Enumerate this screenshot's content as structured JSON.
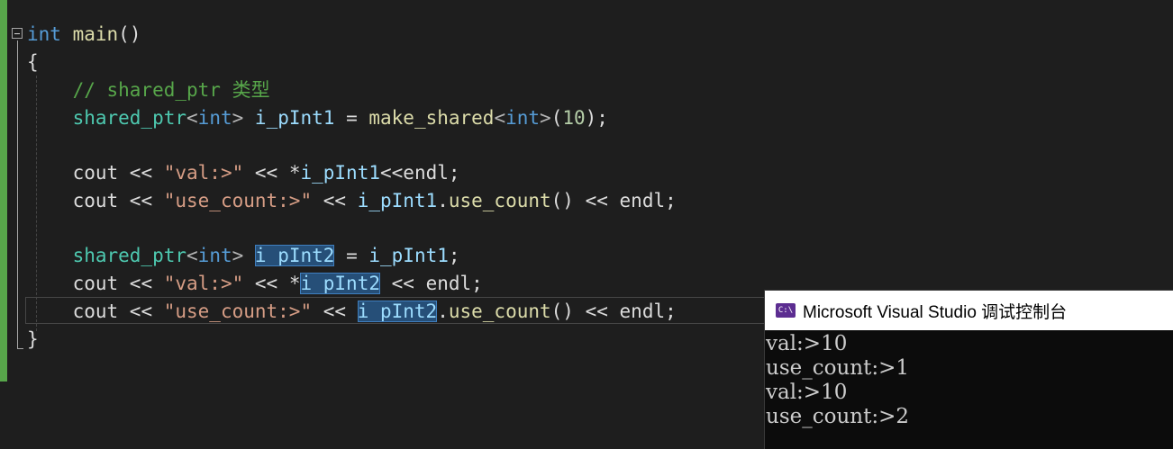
{
  "editor": {
    "lines": {
      "l1": {
        "kw_int": "int",
        "fn": "main",
        "paren": "()"
      },
      "l2": {
        "brace": "{"
      },
      "l3": {
        "comment": "// shared_ptr 类型"
      },
      "l4": {
        "type": "shared_ptr",
        "lt": "<",
        "kw": "int",
        "gt": ">",
        "var": "i_pInt1",
        "eq": " = ",
        "fn": "make_shared",
        "lt2": "<",
        "kw2": "int",
        "gt2": ">",
        "open": "(",
        "num": "10",
        "close": ");"
      },
      "l6": {
        "cout": "cout",
        "op1": " << ",
        "str": "\"val:>\"",
        "op2": " << ",
        "star": "*",
        "var": "i_pInt1",
        "op3": "<<",
        "endl": "endl",
        "semi": ";"
      },
      "l7": {
        "cout": "cout",
        "op1": " << ",
        "str": "\"use_count:>\"",
        "op2": " << ",
        "var": "i_pInt1",
        "dot": ".",
        "fn": "use_count",
        "paren": "()",
        "op3": " << ",
        "endl": "endl",
        "semi": ";"
      },
      "l9": {
        "type": "shared_ptr",
        "lt": "<",
        "kw": "int",
        "gt": ">",
        "var": "i_pInt2",
        "eq": " = ",
        "var2": "i_pInt1",
        "semi": ";"
      },
      "l10": {
        "cout": "cout",
        "op1": " << ",
        "str": "\"val:>\"",
        "op2": " << ",
        "star": "*",
        "var": "i_pInt2",
        "op3": " << ",
        "endl": "endl",
        "semi": ";"
      },
      "l11": {
        "cout": "cout",
        "op1": " << ",
        "str": "\"use_count:>\"",
        "op2": " << ",
        "var": "i_pInt2",
        "dot": ".",
        "fn": "use_count",
        "paren": "()",
        "op3": " << ",
        "endl": "endl",
        "semi": ";"
      },
      "l12": {
        "brace": "}"
      }
    }
  },
  "console": {
    "title": "Microsoft Visual Studio 调试控制台",
    "icon": "console-app-icon",
    "icon_glyph": "C:\\",
    "output": [
      "val:>10",
      "use_count:>1",
      "val:>10",
      "use_count:>2"
    ]
  }
}
